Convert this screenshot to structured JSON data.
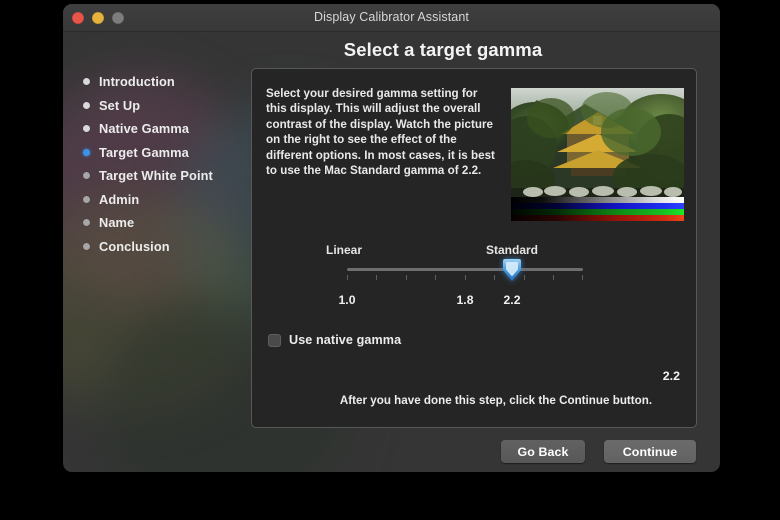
{
  "window": {
    "title": "Display Calibrator Assistant",
    "traffic_lights": [
      "close-button",
      "minimize-button",
      "zoom-button"
    ]
  },
  "heading": "Select a target gamma",
  "sidebar": {
    "items": [
      {
        "label": "Introduction",
        "state": "done"
      },
      {
        "label": "Set Up",
        "state": "done"
      },
      {
        "label": "Native Gamma",
        "state": "done"
      },
      {
        "label": "Target Gamma",
        "state": "active"
      },
      {
        "label": "Target White Point",
        "state": "pending"
      },
      {
        "label": "Admin",
        "state": "pending"
      },
      {
        "label": "Name",
        "state": "pending"
      },
      {
        "label": "Conclusion",
        "state": "pending"
      }
    ]
  },
  "panel": {
    "description": "Select your desired gamma setting for this display. This will adjust the overall contrast of the display. Watch the picture on the right to see the effect of the different options. In most cases, it is best to use the Mac Standard gamma of 2.2.",
    "preview": {
      "alt": "temple-photograph-preview",
      "color_bars": [
        "white-gradient-bar",
        "blue-gradient-bar",
        "green-gradient-bar",
        "red-gradient-bar"
      ]
    },
    "slider": {
      "left_caption": "Linear",
      "right_caption": "Standard",
      "tick_count": 9,
      "scale_labels": [
        {
          "text": "1.0",
          "position_pct": 0
        },
        {
          "text": "1.8",
          "position_pct": 50
        },
        {
          "text": "2.2",
          "position_pct": 70
        }
      ],
      "value_position_pct": 70
    },
    "checkbox": {
      "label": "Use native gamma",
      "checked": false
    },
    "gamma_value": "2.2",
    "footnote": "After you have done this step, click the Continue button."
  },
  "footer": {
    "back_label": "Go Back",
    "continue_label": "Continue"
  },
  "colors": {
    "accent": "#3c92e8",
    "window_bg": "#3a3a3a",
    "panel_bg": "#252525",
    "text": "#ececec"
  }
}
